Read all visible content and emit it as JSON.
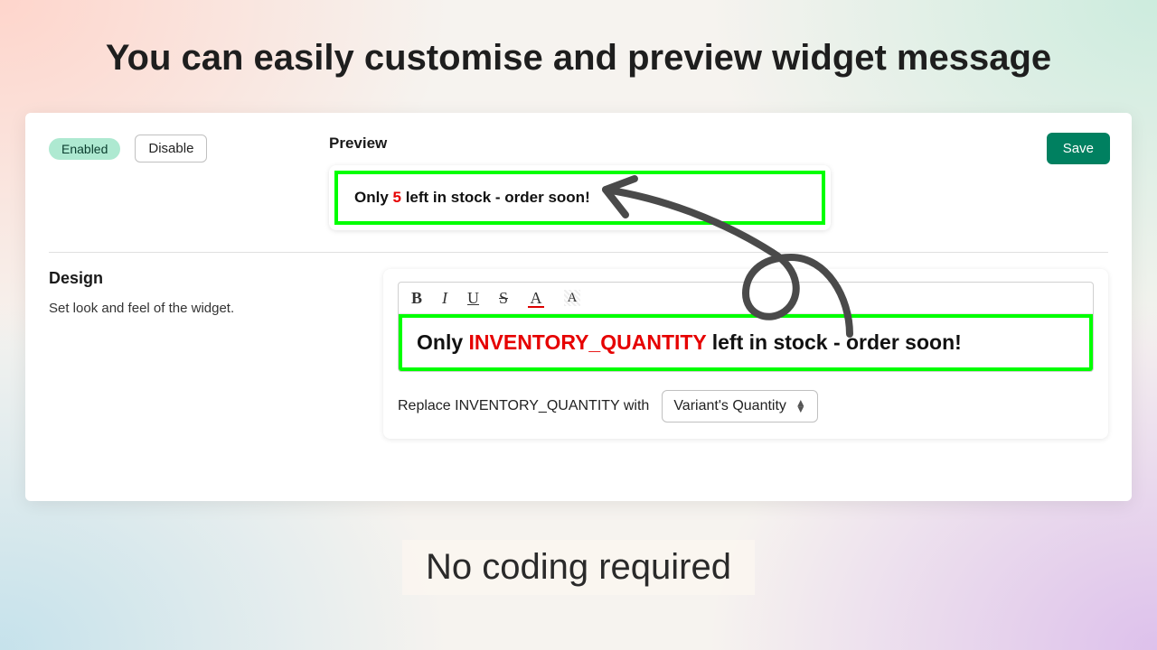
{
  "headline": "You can easily customise and preview widget message",
  "footer_caption": "No coding required",
  "status": {
    "enabled_label": "Enabled",
    "disable_button": "Disable"
  },
  "save_button": "Save",
  "preview": {
    "label": "Preview",
    "text_before": "Only ",
    "quantity": "5",
    "text_after": " left in stock - order soon!"
  },
  "design": {
    "title": "Design",
    "subtitle": "Set look and feel of the widget."
  },
  "editor": {
    "toolbar": {
      "bold": "B",
      "italic": "I",
      "underline": "U",
      "strike": "S",
      "text_color": "A",
      "bg_color": "A"
    },
    "body_before": "Only ",
    "body_token": "INVENTORY_QUANTITY",
    "body_after": " left in stock - order soon!"
  },
  "replace": {
    "label": "Replace INVENTORY_QUANTITY with",
    "selected": "Variant's Quantity"
  },
  "colors": {
    "accent_green": "#008060",
    "pill_green": "#AEE9D1",
    "highlight_border": "#00ff00",
    "red": "#e60000"
  }
}
